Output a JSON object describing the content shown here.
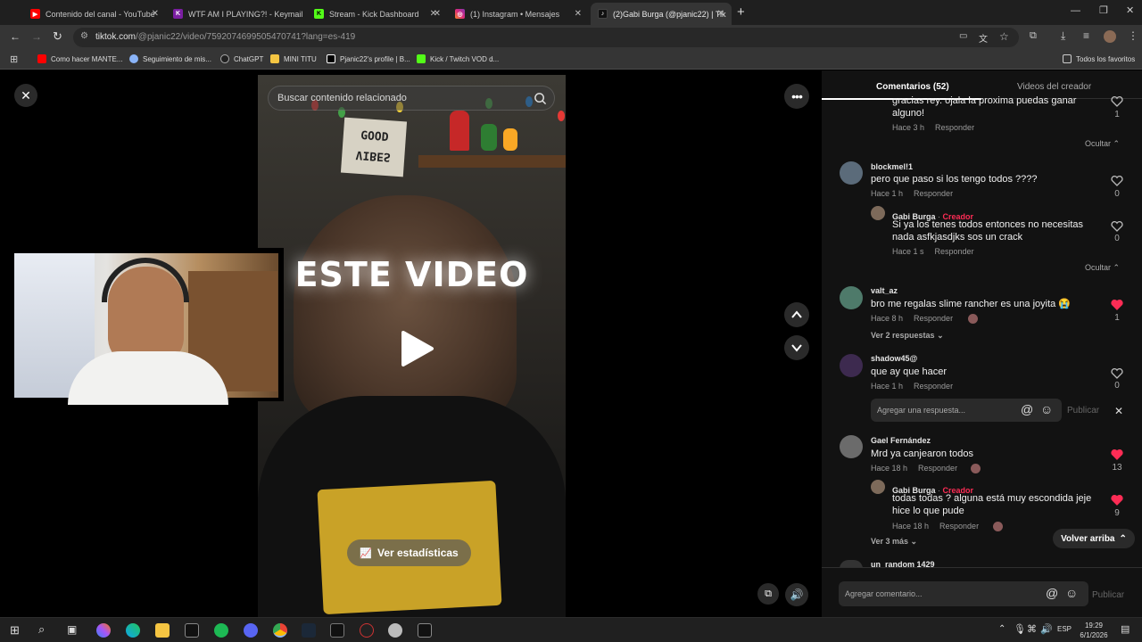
{
  "browser": {
    "tabs": [
      {
        "title": "Contenido del canal - YouTube",
        "icon": "youtube-icon",
        "color": "#ff0000"
      },
      {
        "title": "WTF AM I PLAYING?! - Keymail",
        "icon": "keymail-icon",
        "color": "#7b1fa2"
      },
      {
        "title": "Stream - Kick Dashboard",
        "icon": "kick-icon",
        "color": "#53fc18"
      },
      {
        "title": "(1) Instagram • Mensajes",
        "icon": "instagram-icon",
        "color": "#e1306c"
      },
      {
        "title": "(2)Gabi Burga (@pjanic22) | Tik",
        "icon": "tiktok-icon",
        "color": "#111111"
      }
    ],
    "new_tab": "+",
    "url_host": "tiktok.com",
    "url_path": "/@pjanic22/video/7592074699505470741?lang=es-419",
    "bookmarks": [
      {
        "label": "Como hacer MANTE...",
        "icon": "youtube-icon",
        "color": "#ff0000"
      },
      {
        "label": "Seguimiento de mis...",
        "icon": "globe-icon",
        "color": "#8ab4f8"
      },
      {
        "label": "ChatGPT",
        "icon": "chatgpt-icon",
        "color": "#202020"
      },
      {
        "label": "MINI TITU",
        "icon": "bookmark-icon",
        "color": "#f4c542"
      },
      {
        "label": "Pjanic22's profile | B...",
        "icon": "b-icon",
        "color": "#000000"
      },
      {
        "label": "Kick / Twitch VOD d...",
        "icon": "kick-icon",
        "color": "#53fc18"
      }
    ],
    "all_favorites": "Todos los favoritos"
  },
  "video": {
    "search_placeholder": "Buscar contenido relacionado",
    "overlay_text": "ESTE VIDEO",
    "stats_button": "Ver estadísticas",
    "poster_text_line1": "GOOD",
    "poster_text_line2": "VIBES"
  },
  "comments_panel": {
    "tab_comments": "Comentarios (52)",
    "tab_creator_videos": "Videos del creador",
    "first_partial": {
      "text": "gracias rey. ojala la proxima puedas ganar alguno!",
      "meta_time": "Hace 3 h",
      "reply": "Responder",
      "likes": "1"
    },
    "hide_label": "Ocultar",
    "comments": [
      {
        "user": "blockmel!1",
        "text": "pero que paso si los tengo todos ????",
        "time": "Hace 1 h",
        "reply": "Responder",
        "likes": "0"
      },
      {
        "user": "valt_az",
        "text": "bro me regalas slime rancher es una joyita 😭",
        "time": "Hace 8 h",
        "reply": "Responder",
        "likes": "1",
        "more": "Ver 2 respuestas"
      },
      {
        "user": "shadow45@",
        "text": "que ay que hacer",
        "time": "Hace 1 h",
        "reply": "Responder",
        "likes": "0"
      },
      {
        "user": "Gael Fernández",
        "text": "Mrd ya canjearon todos",
        "time": "Hace 18 h",
        "reply": "Responder",
        "likes": "13",
        "more": "Ver 3 más"
      },
      {
        "user": "un_random 1429"
      }
    ],
    "replies": [
      {
        "user": "Gabi Burga",
        "badge": "Creador",
        "text": "Si ya los tenes todos entonces no necesitas nada asfkjasdjks sos un crack",
        "time": "Hace 1 s",
        "reply": "Responder",
        "likes": "0"
      },
      {
        "user": "Gabi Burga",
        "badge": "Creador",
        "text": "todas todas ? alguna está muy escondida jeje hice lo que pude",
        "time": "Hace 18 h",
        "reply": "Responder",
        "likes": "9"
      }
    ],
    "reply_input_placeholder": "Agregar una respuesta...",
    "reply_publish": "Publicar",
    "back_to_top": "Volver arriba",
    "comment_input_placeholder": "Agregar comentario...",
    "comment_publish": "Publicar"
  },
  "taskbar": {
    "language": "ESP",
    "time": "19:29",
    "date": "6/1/2026"
  },
  "colors": {
    "accent": "#fe2c55",
    "panel_bg": "#121212"
  }
}
